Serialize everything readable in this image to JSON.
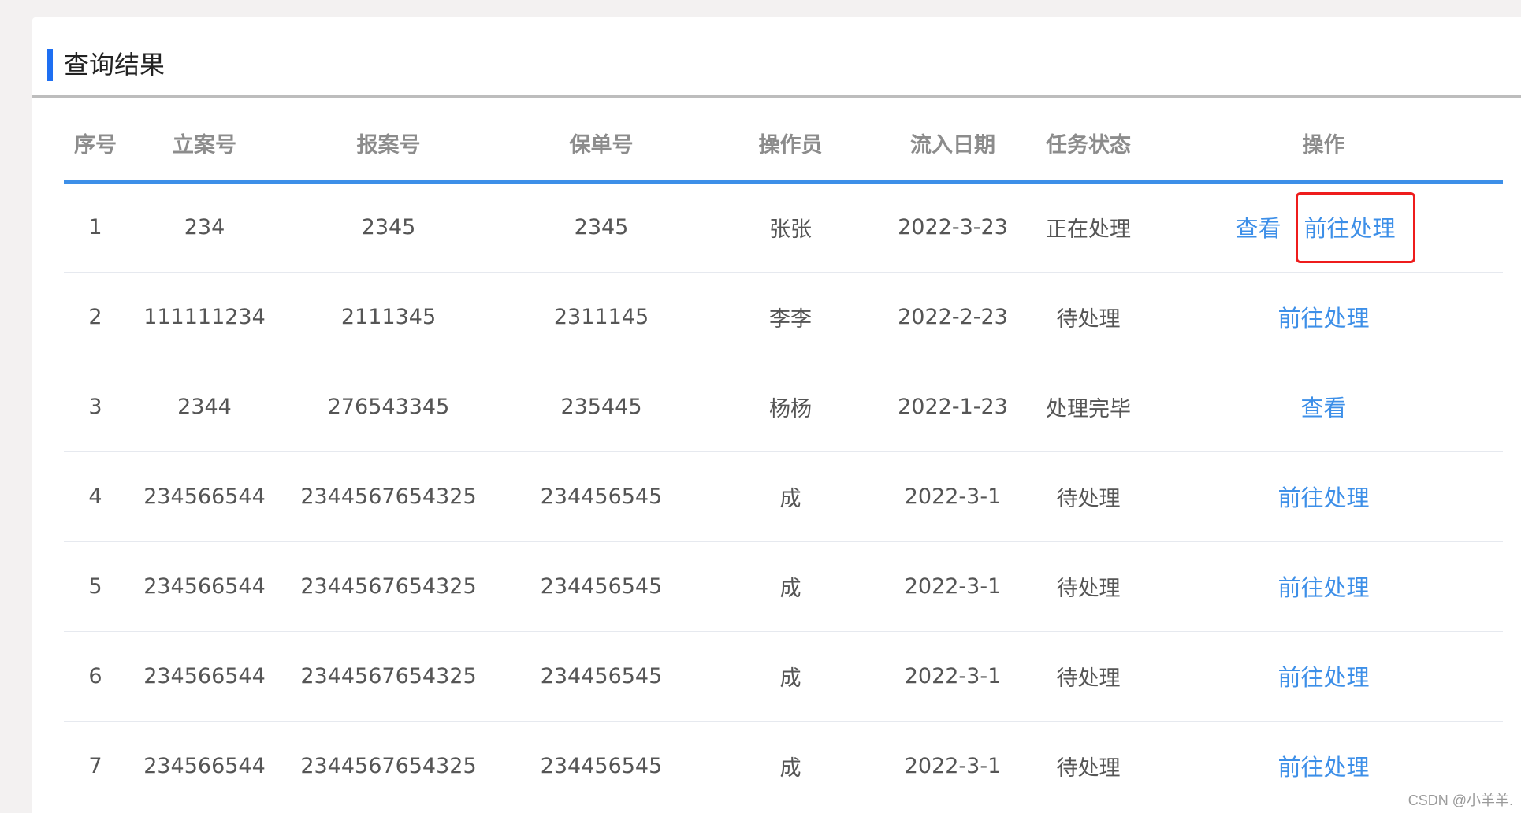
{
  "panel": {
    "title": "查询结果"
  },
  "table": {
    "columns": [
      "序号",
      "立案号",
      "报案号",
      "保单号",
      "操作员",
      "流入日期",
      "任务状态",
      "操作"
    ],
    "rows": [
      {
        "index": "1",
        "case_no": "234",
        "report_no": "2345",
        "policy_no": "2345",
        "operator": "张张",
        "date": "2022-3-23",
        "status": "正在处理",
        "actions": [
          "查看",
          "前往处理"
        ]
      },
      {
        "index": "2",
        "case_no": "111111234",
        "report_no": "2111345",
        "policy_no": "2311145",
        "operator": "李李",
        "date": "2022-2-23",
        "status": "待处理",
        "actions": [
          "前往处理"
        ]
      },
      {
        "index": "3",
        "case_no": "2344",
        "report_no": "276543345",
        "policy_no": "235445",
        "operator": "杨杨",
        "date": "2022-1-23",
        "status": "处理完毕",
        "actions": [
          "查看"
        ]
      },
      {
        "index": "4",
        "case_no": "234566544",
        "report_no": "2344567654325",
        "policy_no": "234456545",
        "operator": "成",
        "date": "2022-3-1",
        "status": "待处理",
        "actions": [
          "前往处理"
        ]
      },
      {
        "index": "5",
        "case_no": "234566544",
        "report_no": "2344567654325",
        "policy_no": "234456545",
        "operator": "成",
        "date": "2022-3-1",
        "status": "待处理",
        "actions": [
          "前往处理"
        ]
      },
      {
        "index": "6",
        "case_no": "234566544",
        "report_no": "2344567654325",
        "policy_no": "234456545",
        "operator": "成",
        "date": "2022-3-1",
        "status": "待处理",
        "actions": [
          "前往处理"
        ]
      },
      {
        "index": "7",
        "case_no": "234566544",
        "report_no": "2344567654325",
        "policy_no": "234456545",
        "operator": "成",
        "date": "2022-3-1",
        "status": "待处理",
        "actions": [
          "前往处理"
        ]
      }
    ]
  },
  "watermark": "CSDN @小羊羊.",
  "colors": {
    "accent": "#1e6ff2",
    "link": "#3d8fe8",
    "highlight_box": "#ee1c1c"
  }
}
